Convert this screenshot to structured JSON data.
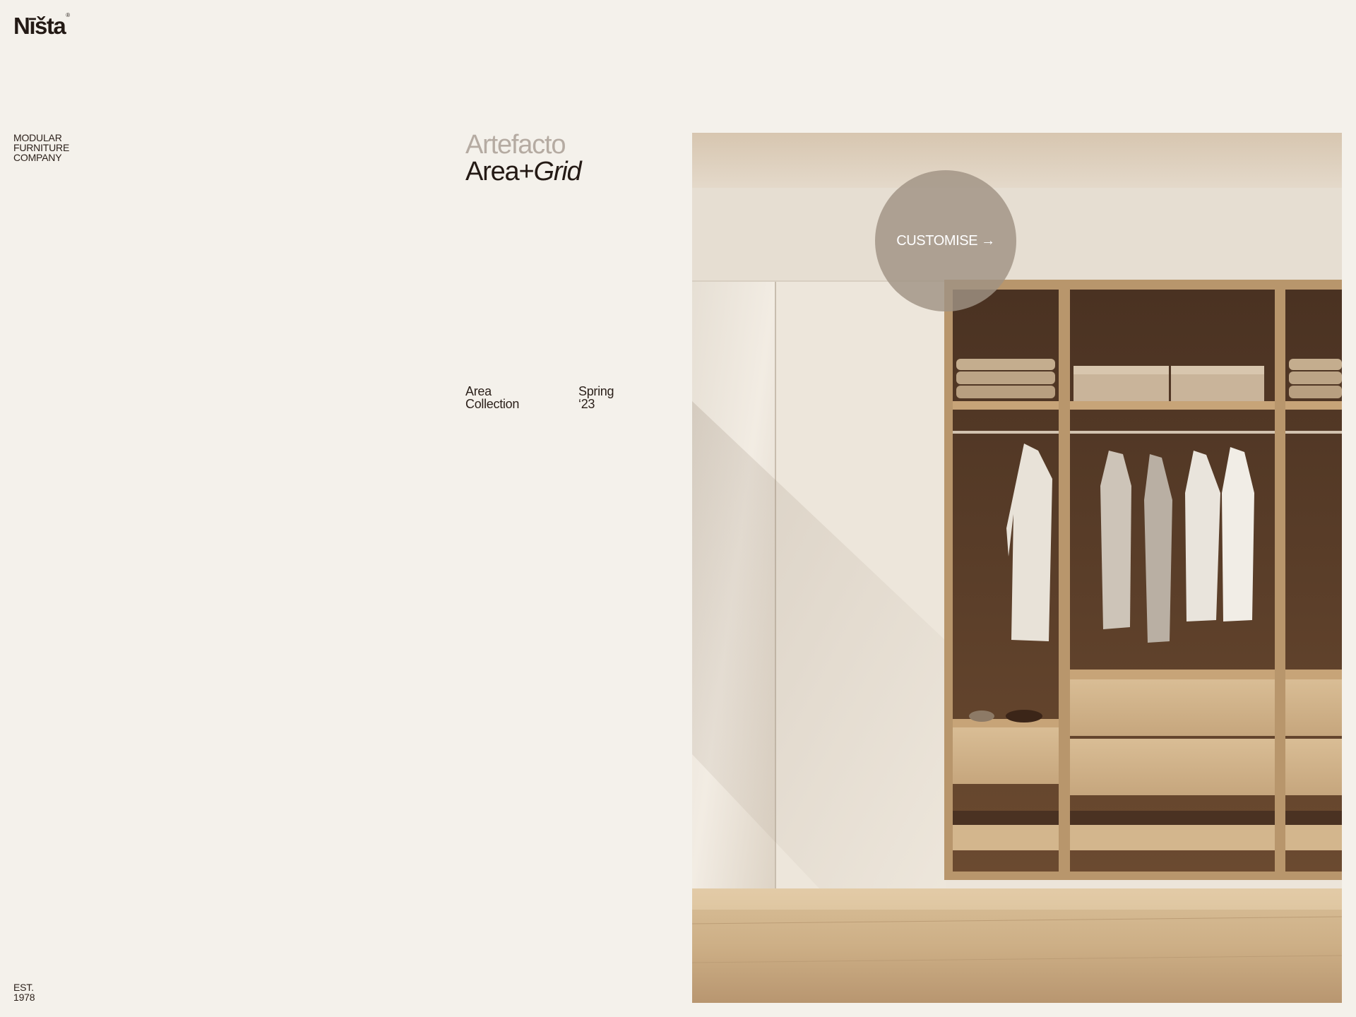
{
  "brand": {
    "logo_text": "Nīšta",
    "registered_mark": "®"
  },
  "tagline": {
    "line1": "MODULAR",
    "line2": "FURNITURE",
    "line3": "COMPANY"
  },
  "title": {
    "brand": "Artefacto",
    "name_regular": "Area+",
    "name_italic": "Grid"
  },
  "meta": {
    "collection_line1": "Area",
    "collection_line2": "Collection",
    "season_line1": "Spring",
    "season_line2": "‘23"
  },
  "cta": {
    "label": "CUSTOMISE",
    "icon": "arrow-right-icon",
    "arrow": "→"
  },
  "hero": {
    "image": "wardrobe-photo",
    "description_colors": {
      "wood": "#b8966c",
      "wall": "#ebe4d9",
      "floor": "#c9ab84"
    }
  },
  "footer": {
    "est_line1": "EST.",
    "est_line2": "1978"
  },
  "colors": {
    "background": "#f4f1eb",
    "text": "#2a1f19",
    "muted_title": "#b5aba2"
  }
}
